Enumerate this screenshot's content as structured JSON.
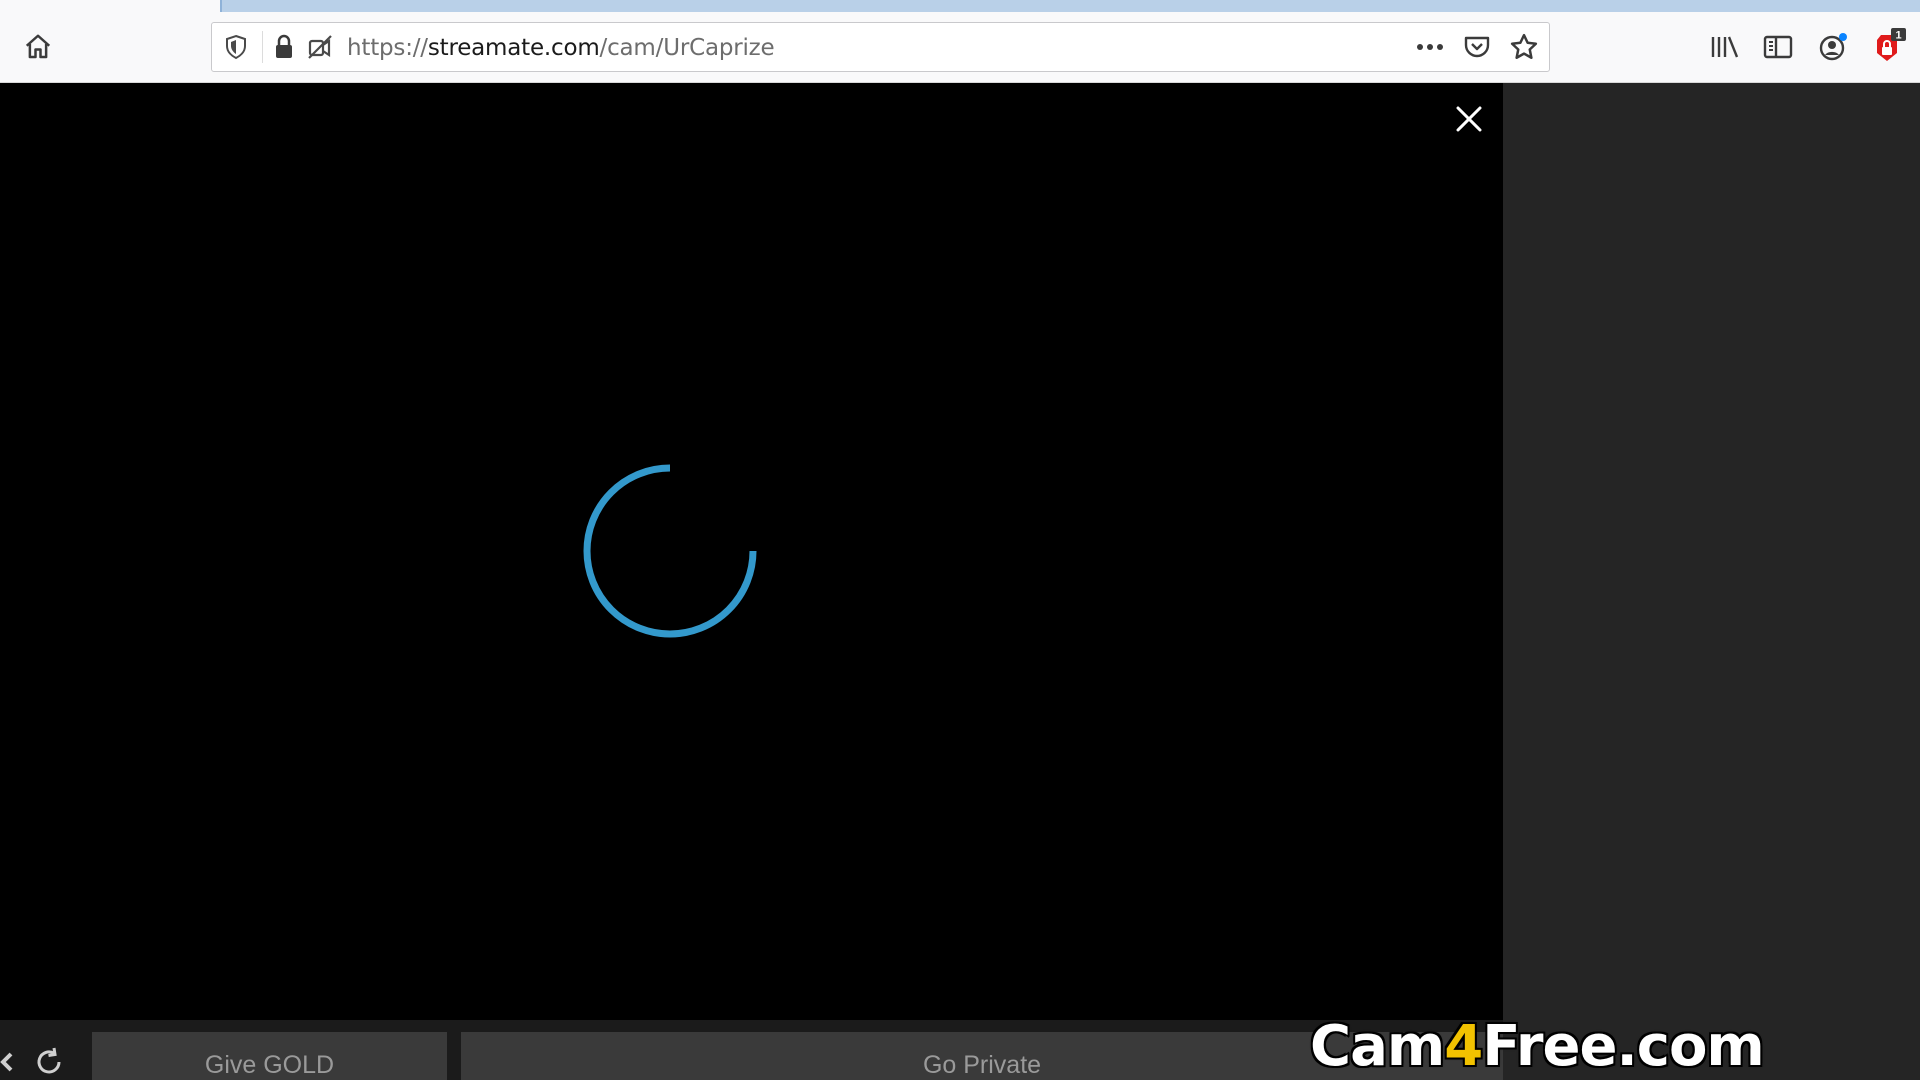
{
  "browser": {
    "url": {
      "scheme": "https://",
      "host": "streamate.com",
      "path": "/cam/UrCaprize"
    },
    "toolbar_icons": [
      "home-icon",
      "shield-icon",
      "lock-icon",
      "permissions-icon",
      "more-icon",
      "pocket-icon",
      "star-icon",
      "library-icon",
      "sidebar-icon",
      "account-icon",
      "extension-icon"
    ],
    "extension_badge": "1",
    "accent_color": "#0a84ff"
  },
  "player": {
    "spinner_color": "#3399cc",
    "close_icon": "close-icon"
  },
  "controls": {
    "give_gold_label": "Give GOLD",
    "go_private_label": "Go Private",
    "refresh_icon": "refresh-icon"
  },
  "watermark": {
    "text_a": "Cam",
    "text_b": "4",
    "text_c": "Free.com"
  }
}
